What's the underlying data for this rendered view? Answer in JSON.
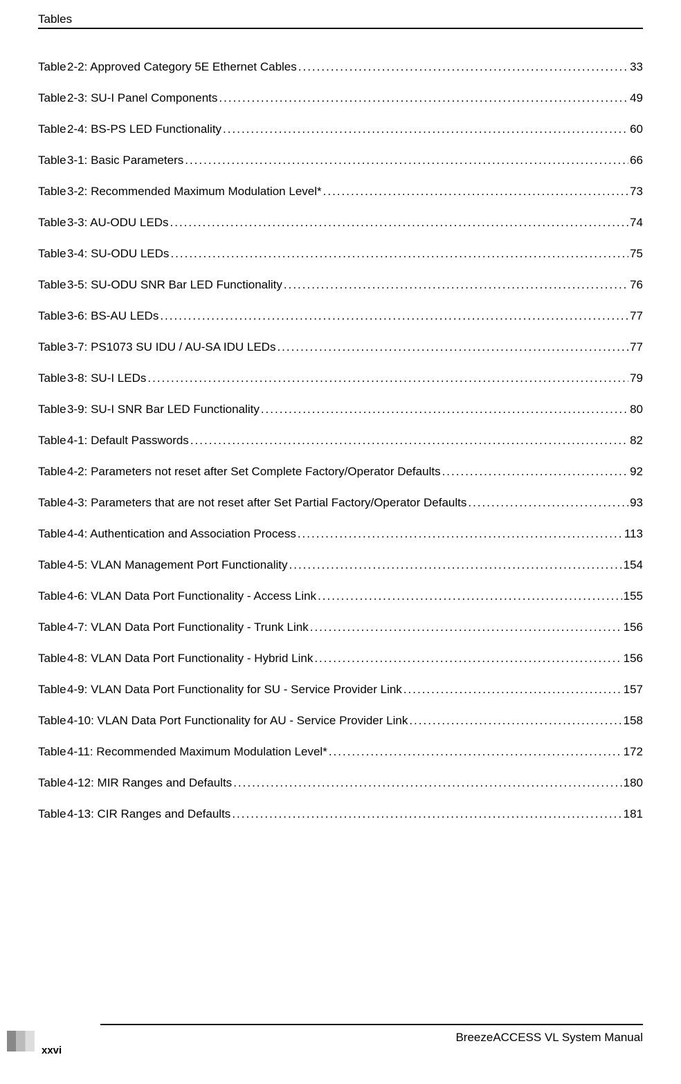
{
  "header": {
    "title": "Tables"
  },
  "toc": [
    {
      "title": "Table 2-2: Approved Category 5E Ethernet Cables",
      "page": "33"
    },
    {
      "title": "Table 2-3: SU-I Panel Components",
      "page": "49"
    },
    {
      "title": "Table 2-4: BS-PS LED Functionality",
      "page": "60"
    },
    {
      "title": "Table 3-1: Basic Parameters",
      "page": "66"
    },
    {
      "title": "Table 3-2: Recommended Maximum Modulation Level*",
      "page": "73"
    },
    {
      "title": "Table 3-3: AU-ODU LEDs",
      "page": "74"
    },
    {
      "title": "Table 3-4: SU-ODU LEDs",
      "page": "75"
    },
    {
      "title": "Table 3-5: SU-ODU SNR Bar LED Functionality",
      "page": "76"
    },
    {
      "title": "Table 3-6: BS-AU LEDs",
      "page": "77"
    },
    {
      "title": "Table 3-7: PS1073 SU IDU / AU-SA IDU LEDs",
      "page": "77"
    },
    {
      "title": "Table 3-8: SU-I LEDs",
      "page": "79"
    },
    {
      "title": "Table 3-9: SU-I SNR Bar LED Functionality",
      "page": "80"
    },
    {
      "title": "Table 4-1: Default Passwords",
      "page": "82"
    },
    {
      "title": "Table 4-2: Parameters not reset after Set Complete Factory/Operator Defaults",
      "page": "92"
    },
    {
      "title": "Table 4-3: Parameters that are not reset after Set Partial Factory/Operator Defaults",
      "page": "93"
    },
    {
      "title": "Table 4-4: Authentication and Association Process",
      "page": "113"
    },
    {
      "title": "Table 4-5: VLAN Management Port Functionality",
      "page": "154"
    },
    {
      "title": "Table 4-6: VLAN Data Port Functionality - Access Link",
      "page": "155"
    },
    {
      "title": "Table 4-7: VLAN Data Port Functionality - Trunk Link",
      "page": "156"
    },
    {
      "title": "Table 4-8: VLAN Data Port Functionality - Hybrid Link",
      "page": "156"
    },
    {
      "title": "Table 4-9: VLAN Data Port Functionality for SU - Service Provider Link",
      "page": "157"
    },
    {
      "title": "Table 4-10: VLAN Data Port Functionality for AU - Service Provider Link",
      "page": "158"
    },
    {
      "title": "Table 4-11: Recommended Maximum Modulation Level*",
      "page": "172"
    },
    {
      "title": "Table 4-12: MIR Ranges and Defaults",
      "page": "180"
    },
    {
      "title": "Table 4-13: CIR Ranges and Defaults",
      "page": "181"
    }
  ],
  "footer": {
    "page_number": "xxvi",
    "manual_title": "BreezeACCESS VL System Manual"
  }
}
